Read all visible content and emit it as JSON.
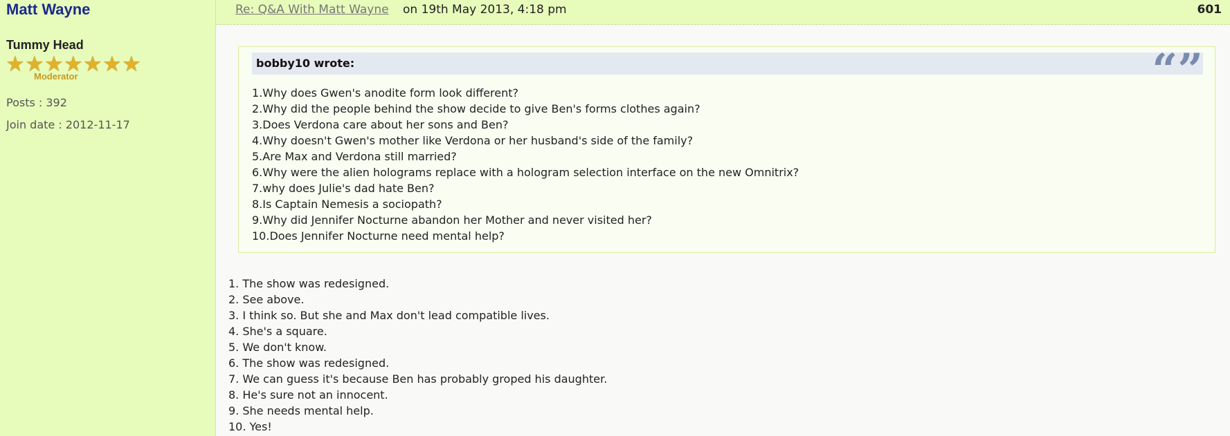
{
  "author": {
    "name": "Matt Wayne",
    "rank_title": "Tummy Head",
    "rank_label": "Moderator",
    "star_count": 7,
    "posts": "Posts : 392",
    "join_date": "Join date : 2012-11-17"
  },
  "post": {
    "title_link": "Re: Q&A With Matt Wayne",
    "meta": "on 19th May 2013, 4:18 pm",
    "number": "601"
  },
  "quote": {
    "author": "bobby10 wrote:",
    "icon": "quote-marks-icon",
    "lines": [
      "1.Why does Gwen's anodite form look different?",
      "2.Why did the people behind the show decide to give Ben's forms clothes again?",
      "3.Does Verdona care about her sons and Ben?",
      "4.Why doesn't Gwen's mother like Verdona or her husband's side of the family?",
      "5.Are Max and Verdona still married?",
      "6.Why were the alien holograms replace with a hologram selection interface on the new Omnitrix?",
      "7.why does Julie's dad hate Ben?",
      "8.Is Captain Nemesis a sociopath?",
      "9.Why did Jennifer Nocturne abandon her Mother and never visited her?",
      "10.Does Jennifer Nocturne need mental help?"
    ]
  },
  "answers": [
    "1. The show was redesigned.",
    "2. See above.",
    "3. I think so. But she and Max don't lead compatible lives.",
    "4. She's a square.",
    "5. We don't know.",
    "6. The show was redesigned.",
    "7. We can guess it's because Ben has probably groped his daughter.",
    "8. He's sure not an innocent.",
    "9. She needs mental help.",
    "10. Yes!"
  ],
  "colors": {
    "sidebar_bg": "#e7fbbb",
    "author_name": "#1b2a8c",
    "star": "#e0b12a",
    "quote_header_bg": "#e4e8f0"
  }
}
